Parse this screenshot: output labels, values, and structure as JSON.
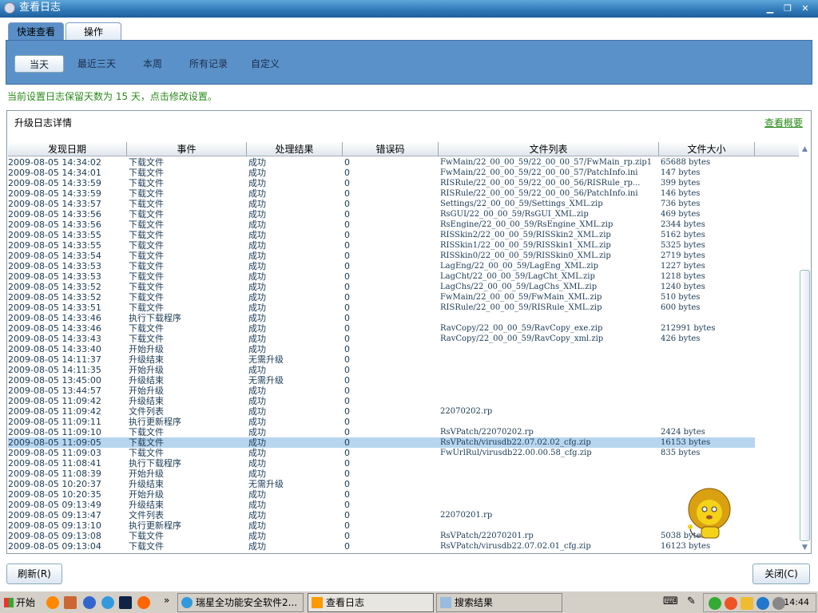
{
  "window": {
    "title": "查看日志"
  },
  "tabs": [
    {
      "label": "快速查看"
    },
    {
      "label": "操作"
    }
  ],
  "quick_filters": [
    "当天",
    "最近三天",
    "本周",
    "所有记录",
    "自定义"
  ],
  "notice": "当前设置日志保留天数为 15 天，点击修改设置。",
  "section": {
    "title": "升级日志详情",
    "link": "查看概要"
  },
  "columns": [
    "发现日期",
    "事件",
    "处理结果",
    "错误码",
    "文件列表",
    "文件大小"
  ],
  "selected_row": 27,
  "rows": [
    [
      "2009-08-05 14:34:02",
      "下载文件",
      "成功",
      "0",
      "FwMain/22_00_00_59/22_00_00_57/FwMain_rp.zip1",
      "65688 bytes"
    ],
    [
      "2009-08-05 14:34:01",
      "下载文件",
      "成功",
      "0",
      "FwMain/22_00_00_59/22_00_00_57/PatchInfo.ini",
      "147 bytes"
    ],
    [
      "2009-08-05 14:33:59",
      "下载文件",
      "成功",
      "0",
      "RISRule/22_00_00_59/22_00_00_56/RISRule_rp...",
      "399 bytes"
    ],
    [
      "2009-08-05 14:33:59",
      "下载文件",
      "成功",
      "0",
      "RISRule/22_00_00_59/22_00_00_56/PatchInfo.ini",
      "146 bytes"
    ],
    [
      "2009-08-05 14:33:57",
      "下载文件",
      "成功",
      "0",
      "Settings/22_00_00_59/Settings_XML.zip",
      "736 bytes"
    ],
    [
      "2009-08-05 14:33:56",
      "下载文件",
      "成功",
      "0",
      "RsGUI/22_00_00_59/RsGUI_XML.zip",
      "469 bytes"
    ],
    [
      "2009-08-05 14:33:56",
      "下载文件",
      "成功",
      "0",
      "RsEngine/22_00_00_59/RsEngine_XML.zip",
      "2344 bytes"
    ],
    [
      "2009-08-05 14:33:55",
      "下载文件",
      "成功",
      "0",
      "RISSkin2/22_00_00_59/RISSkin2_XML.zip",
      "5162 bytes"
    ],
    [
      "2009-08-05 14:33:55",
      "下载文件",
      "成功",
      "0",
      "RISSkin1/22_00_00_59/RISSkin1_XML.zip",
      "5325 bytes"
    ],
    [
      "2009-08-05 14:33:54",
      "下载文件",
      "成功",
      "0",
      "RISSkin0/22_00_00_59/RISSkin0_XML.zip",
      "2719 bytes"
    ],
    [
      "2009-08-05 14:33:53",
      "下载文件",
      "成功",
      "0",
      "LagEng/22_00_00_59/LagEng_XML.zip",
      "1227 bytes"
    ],
    [
      "2009-08-05 14:33:53",
      "下载文件",
      "成功",
      "0",
      "LagCht/22_00_00_59/LagCht_XML.zip",
      "1218 bytes"
    ],
    [
      "2009-08-05 14:33:52",
      "下载文件",
      "成功",
      "0",
      "LagChs/22_00_00_59/LagChs_XML.zip",
      "1240 bytes"
    ],
    [
      "2009-08-05 14:33:52",
      "下载文件",
      "成功",
      "0",
      "FwMain/22_00_00_59/FwMain_XML.zip",
      "510 bytes"
    ],
    [
      "2009-08-05 14:33:51",
      "下载文件",
      "成功",
      "0",
      "RISRule/22_00_00_59/RISRule_XML.zip",
      "600 bytes"
    ],
    [
      "2009-08-05 14:33:46",
      "执行下载程序",
      "成功",
      "0",
      "",
      ""
    ],
    [
      "2009-08-05 14:33:46",
      "下载文件",
      "成功",
      "0",
      "RavCopy/22_00_00_59/RavCopy_exe.zip",
      "212991 bytes"
    ],
    [
      "2009-08-05 14:33:43",
      "下载文件",
      "成功",
      "0",
      "RavCopy/22_00_00_59/RavCopy_xml.zip",
      "426 bytes"
    ],
    [
      "2009-08-05 14:33:40",
      "开始升级",
      "成功",
      "0",
      "",
      ""
    ],
    [
      "2009-08-05 14:11:37",
      "升级结束",
      "无需升级",
      "0",
      "",
      ""
    ],
    [
      "2009-08-05 14:11:35",
      "开始升级",
      "成功",
      "0",
      "",
      ""
    ],
    [
      "2009-08-05 13:45:00",
      "升级结束",
      "无需升级",
      "0",
      "",
      ""
    ],
    [
      "2009-08-05 13:44:57",
      "开始升级",
      "成功",
      "0",
      "",
      ""
    ],
    [
      "2009-08-05 11:09:42",
      "升级结束",
      "成功",
      "0",
      "",
      ""
    ],
    [
      "2009-08-05 11:09:42",
      "文件列表",
      "成功",
      "0",
      "22070202.rp",
      ""
    ],
    [
      "2009-08-05 11:09:11",
      "执行更新程序",
      "成功",
      "0",
      "",
      ""
    ],
    [
      "2009-08-05 11:09:10",
      "下载文件",
      "成功",
      "0",
      "RsVPatch/22070202.rp",
      "2424 bytes"
    ],
    [
      "2009-08-05 11:09:05",
      "下载文件",
      "成功",
      "0",
      "RsVPatch/virusdb22.07.02.02_cfg.zip",
      "16153 bytes"
    ],
    [
      "2009-08-05 11:09:03",
      "下载文件",
      "成功",
      "0",
      "FwUrlRul/virusdb22.00.00.58_cfg.zip",
      "835 bytes"
    ],
    [
      "2009-08-05 11:08:41",
      "执行下载程序",
      "成功",
      "0",
      "",
      ""
    ],
    [
      "2009-08-05 11:08:39",
      "开始升级",
      "成功",
      "0",
      "",
      ""
    ],
    [
      "2009-08-05 10:20:37",
      "升级结束",
      "无需升级",
      "0",
      "",
      ""
    ],
    [
      "2009-08-05 10:20:35",
      "开始升级",
      "成功",
      "0",
      "",
      ""
    ],
    [
      "2009-08-05 09:13:49",
      "升级结束",
      "成功",
      "0",
      "",
      ""
    ],
    [
      "2009-08-05 09:13:47",
      "文件列表",
      "成功",
      "0",
      "22070201.rp",
      ""
    ],
    [
      "2009-08-05 09:13:10",
      "执行更新程序",
      "成功",
      "0",
      "",
      ""
    ],
    [
      "2009-08-05 09:13:08",
      "下载文件",
      "成功",
      "0",
      "RsVPatch/22070201.rp",
      "5038 bytes"
    ],
    [
      "2009-08-05 09:13:04",
      "下载文件",
      "成功",
      "0",
      "RsVPatch/virusdb22.07.02.01_cfg.zip",
      "16123 bytes"
    ]
  ],
  "buttons": {
    "refresh": "刷新(R)",
    "close": "关闭(C)"
  },
  "taskbar": {
    "start": "开始",
    "tasks": [
      "瑞星全功能安全软件2...",
      "查看日志",
      "搜索结果"
    ],
    "clock": "14:44",
    "overflow": "»"
  }
}
